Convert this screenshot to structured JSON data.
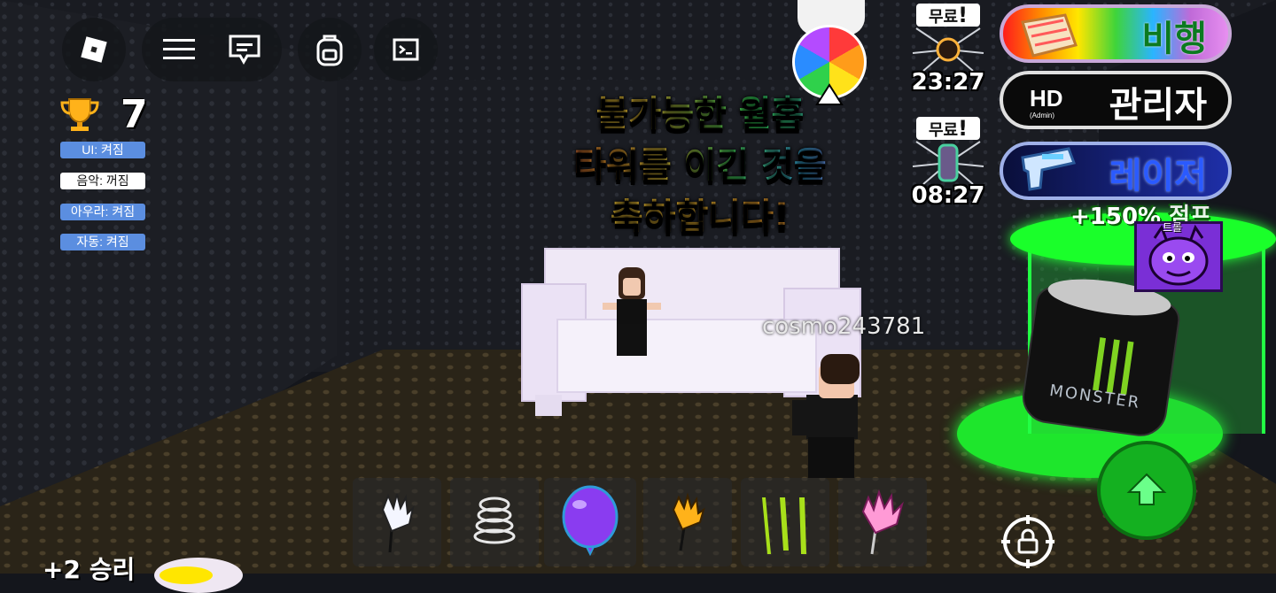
{
  "toolbar": {
    "roblox_icon": "roblox-logo-icon",
    "menu_icon": "hamburger-menu-icon",
    "chat_icon": "chat-icon",
    "backpack_icon": "backpack-icon",
    "console_icon": "terminal-icon"
  },
  "stats": {
    "trophy_icon": "trophy-icon",
    "trophy_count": "7"
  },
  "toggles": [
    {
      "label": "UI: 켜짐",
      "state": "on"
    },
    {
      "label": "음악: 꺼짐",
      "state": "off"
    },
    {
      "label": "아우라: 켜짐",
      "state": "on"
    },
    {
      "label": "자동: 켜짐",
      "state": "on"
    }
  ],
  "banner": {
    "line1": "불가능한 월홉",
    "line2": "타워를 이긴 것을",
    "line3": "축하합니다!"
  },
  "player": {
    "name": "cosmo243781"
  },
  "rewards": [
    {
      "tag": "무료",
      "bang": "!",
      "timer": "23:27",
      "icon": "dark-planet-icon"
    },
    {
      "tag": "무료",
      "bang": "!",
      "timer": "08:27",
      "icon": "rainbow-arm-icon"
    }
  ],
  "right_buttons": {
    "fly": {
      "label": "비행",
      "icon": "rainbow-carpet-icon",
      "color": "#0c7a20"
    },
    "admin": {
      "label": "관리자",
      "badge": "HD",
      "badge_sub": "(Admin)"
    },
    "laser": {
      "label": "레이저",
      "icon": "laser-gun-icon"
    }
  },
  "boost": {
    "text": "+150%",
    "tail": "점프"
  },
  "troll": {
    "label": "트롤",
    "icon": "purple-devil-icon"
  },
  "hotbar": [
    {
      "icon": "white-glove-stick-icon"
    },
    {
      "icon": "spring-coil-icon"
    },
    {
      "icon": "purple-balloon-icon"
    },
    {
      "icon": "gold-glove-stick-icon"
    },
    {
      "icon": "monster-claw-icon"
    },
    {
      "icon": "pink-glove-stick-icon"
    }
  ],
  "controls": {
    "jump_icon": "jump-arrow-icon",
    "shiftlock_icon": "shift-lock-icon"
  },
  "wins": {
    "text": "+2 승리"
  },
  "colors": {
    "toggle_on": "#5b8ee0",
    "toggle_off": "#ffffff",
    "jump_green": "#14b020",
    "podium_green": "#1aff2a"
  }
}
